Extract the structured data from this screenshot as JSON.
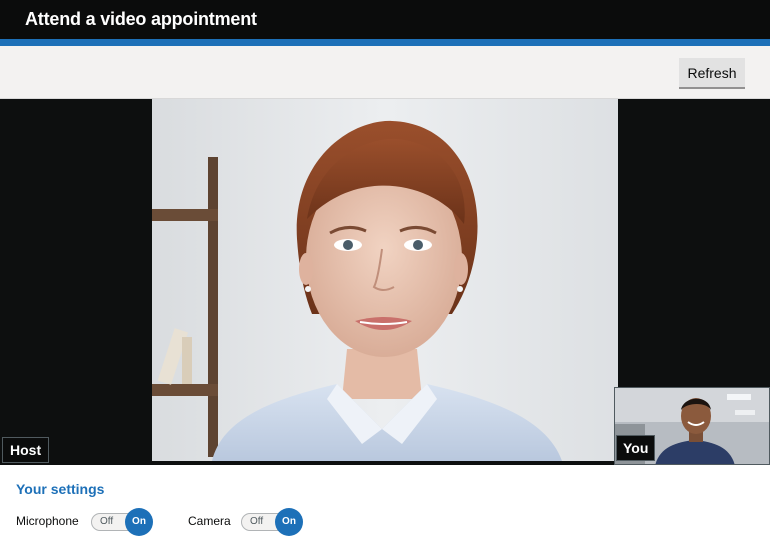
{
  "header": {
    "title": "Attend a video appointment"
  },
  "toolbar": {
    "refresh_label": "Refresh"
  },
  "video": {
    "host_label": "Host",
    "self_label": "You"
  },
  "settings": {
    "title": "Your settings",
    "microphone": {
      "label": "Microphone",
      "off_label": "Off",
      "on_label": "On",
      "state": "on"
    },
    "camera": {
      "label": "Camera",
      "off_label": "Off",
      "on_label": "On",
      "state": "on"
    }
  },
  "colors": {
    "header_bg": "#0b0c0c",
    "accent_bar": "#1d70b8",
    "toggle_on": "#1d70b8",
    "settings_title": "#1d70b8"
  }
}
